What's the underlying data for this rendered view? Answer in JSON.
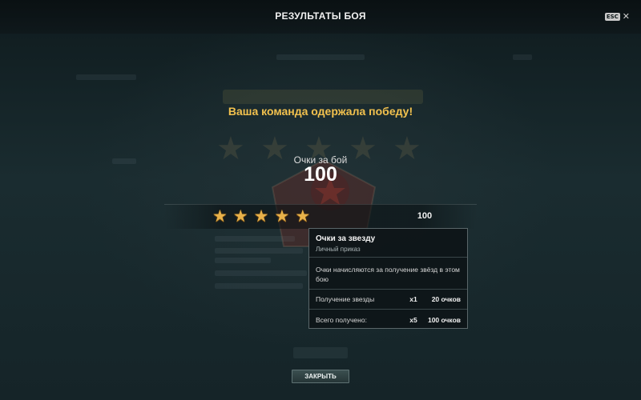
{
  "header": {
    "title": "РЕЗУЛЬТАТЫ БОЯ",
    "esc_label": "ESC",
    "close_symbol": "✕"
  },
  "result": {
    "victory_text": "Ваша команда одержала победу!",
    "score_label": "Очки за бой",
    "score_value": "100"
  },
  "stars_row": {
    "stars_count": 5,
    "value": "100"
  },
  "tooltip": {
    "title": "Очки за звезду",
    "subtitle": "Личный приказ",
    "description": "Очки начисляются за получение звёзд в этом бою",
    "rows": [
      {
        "label": "Получение звезды",
        "multiplier": "x1",
        "points": "20 очков"
      },
      {
        "label": "Всего получено:",
        "multiplier": "x5",
        "points": "100 очков"
      }
    ]
  },
  "footer": {
    "close_button": "ЗАКРЫТЬ"
  },
  "colors": {
    "accent_gold": "#f2c14e",
    "star": "#e8b24a",
    "background": "#142326"
  },
  "icons": {
    "star": "star-icon",
    "close": "close-icon",
    "badge": "emblem-icon"
  }
}
